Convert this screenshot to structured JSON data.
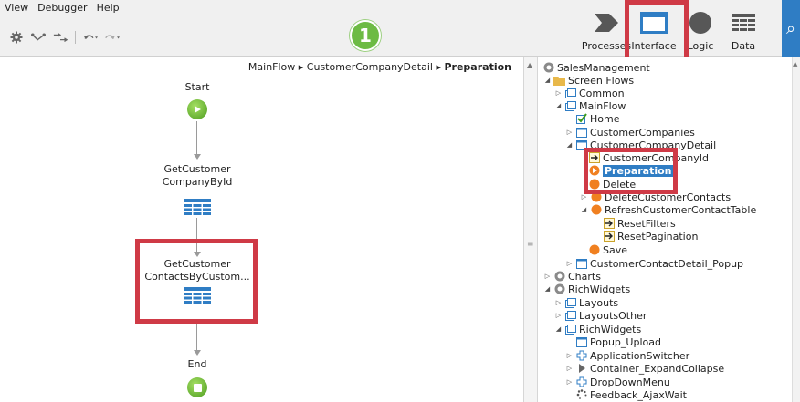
{
  "menu": [
    "View",
    "Debugger",
    "Help"
  ],
  "step_badge": "1",
  "tabs": [
    {
      "label": "Processes",
      "icon": "processes-chevron-icon"
    },
    {
      "label": "Interface",
      "icon": "interface-window-icon"
    },
    {
      "label": "Logic",
      "icon": "logic-circle-icon"
    },
    {
      "label": "Data",
      "icon": "data-grid-icon"
    }
  ],
  "breadcrumb": {
    "path": "MainFlow ▸ CustomerCompanyDetail ▸ ",
    "current": "Preparation"
  },
  "flow": {
    "start": "Start",
    "node1_line1": "GetCustomer",
    "node1_line2": "CompanyById",
    "node2_line1": "GetCustomer",
    "node2_line2": "ContactsByCustom...",
    "end": "End"
  },
  "tree": [
    "SalesManagement",
    "Screen Flows",
    "Common",
    "MainFlow",
    "Home",
    "CustomerCompanies",
    "CustomerCompanyDetail",
    "CustomerCompanyId",
    "Preparation",
    "Delete",
    "DeleteCustomerContacts",
    "RefreshCustomerContactTable",
    "ResetFilters",
    "ResetPagination",
    "Save",
    "CustomerContactDetail_Popup",
    "Charts",
    "RichWidgets",
    "Layouts",
    "LayoutsOther",
    "RichWidgets",
    "Popup_Upload",
    "ApplicationSwitcher",
    "Container_ExpandCollapse",
    "DropDownMenu",
    "Feedback_AjaxWait"
  ],
  "colors": {
    "highlight": "#cf3a46",
    "accent": "#2f7dc4",
    "green": "#6dbb44"
  }
}
